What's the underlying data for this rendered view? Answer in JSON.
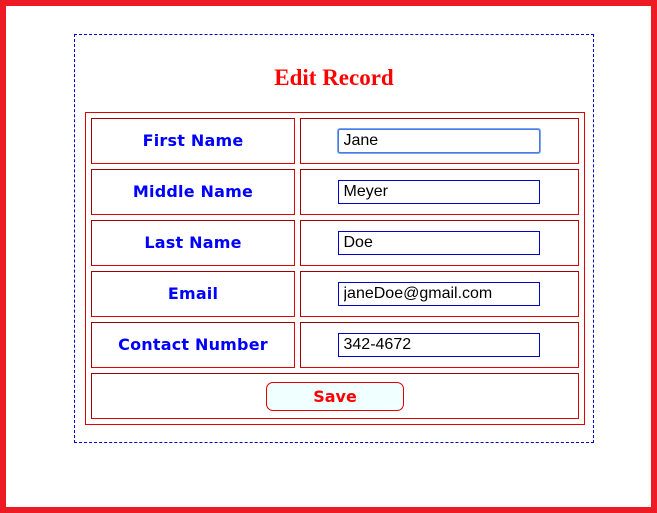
{
  "page": {
    "title": "Edit Record"
  },
  "form": {
    "fields": [
      {
        "label": "First Name",
        "value": "Jane",
        "focused": true
      },
      {
        "label": "Middle Name",
        "value": "Meyer",
        "focused": false
      },
      {
        "label": "Last Name",
        "value": "Doe",
        "focused": false
      },
      {
        "label": "Email",
        "value": "janeDoe@gmail.com",
        "focused": false
      },
      {
        "label": "Contact Number",
        "value": "342-4672",
        "focused": false
      }
    ],
    "save_label": "Save"
  },
  "colors": {
    "frame_border": "#ed1c24",
    "container_border": "#0000cc",
    "title": "#ff0000",
    "label_text": "#0000ff",
    "table_border": "#e00000",
    "input_border": "#0000cc",
    "button_background": "#f0ffff",
    "button_text": "#ff0000"
  }
}
